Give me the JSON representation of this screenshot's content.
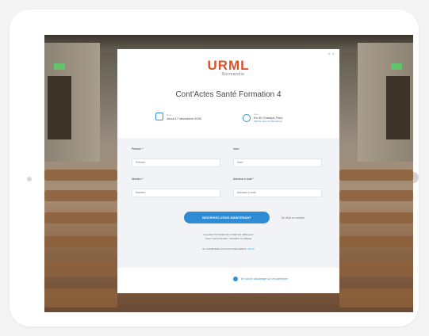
{
  "brand": {
    "logo_text": "URML",
    "logo_subtext": "Normandie",
    "accent": "#d9532c",
    "primary": "#2f8bd4"
  },
  "event": {
    "title": "Cont'Actes Santé Formation 4",
    "date_label": "Date",
    "date_value": "Jeudi 17 décembre 2020",
    "place_label": "Lieu",
    "place_value": "En 4h Champs Flors",
    "place_link": "Afficher plus d'informations"
  },
  "form": {
    "fields": [
      {
        "label": "Prénom *",
        "placeholder": "Prénom"
      },
      {
        "label": "Nom",
        "placeholder": "Nom"
      },
      {
        "label": "Numéro *",
        "placeholder": "Numéro"
      },
      {
        "label": "Adresse e-mail *",
        "placeholder": "Adresse e-mail"
      }
    ],
    "submit_label": "INSCRIVEZ-VOUS MAINTENANT",
    "forgot_label": "J'ai déjà un compte",
    "note_line1": "Le présent formulaire de contact est utilisé pour",
    "note_line2": "mieux vous connaître. Consultez la politique",
    "note_line3": "de confidentialité pour plus d'informations.",
    "note_link": "Lire ici",
    "footer_link": "En savoir davantage sur ce partenaire"
  },
  "window": {
    "close_label": "× ×"
  }
}
